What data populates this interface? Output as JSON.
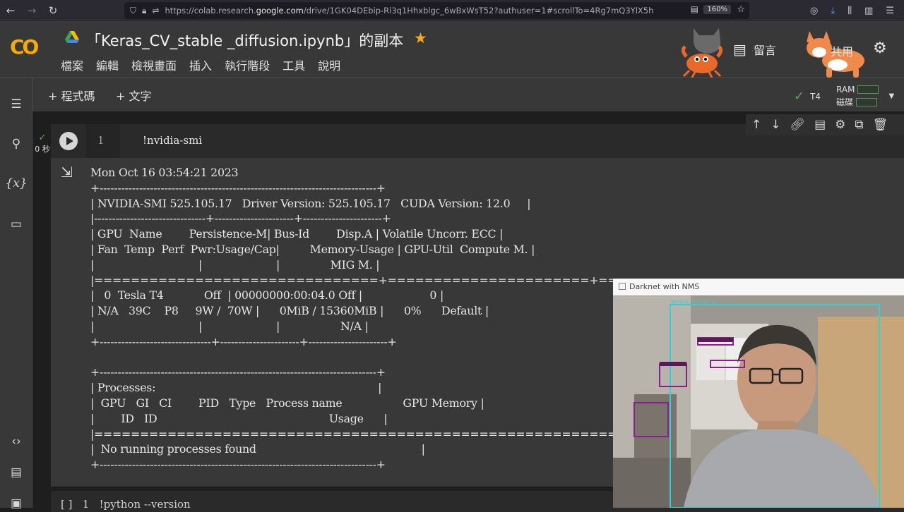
{
  "browser": {
    "url_prefix": "https://colab.research.",
    "url_domain": "google.com",
    "url_path": "/drive/1GK04DEbip-Ri3q1Hhxblgc_6wBxWsT52?authuser=1#scrollTo=4Rg7mQ3YlX5h",
    "zoom": "160%"
  },
  "header": {
    "logo": "CO",
    "title": "「Keras_CV_stable _diffusion.ipynb」的副本",
    "menu": [
      "檔案",
      "編輯",
      "檢視畫面",
      "插入",
      "執行階段",
      "工具",
      "說明"
    ],
    "comment_label": "留言",
    "share_label": "共用"
  },
  "toolbar": {
    "add_code": "+ 程式碼",
    "add_text": "+ 文字",
    "runtime_type": "T4",
    "ram_label": "RAM",
    "disk_label": "磁碟"
  },
  "cell": {
    "exec_time": "0 秒",
    "line_number": "1",
    "code": "!nvidia-smi"
  },
  "output": {
    "lines": [
      "Mon Oct 16 03:54:21 2023",
      "+-----------------------------------------------------------------------------+",
      "| NVIDIA-SMI 525.105.17   Driver Version: 525.105.17   CUDA Version: 12.0     |",
      "|-------------------------------+----------------------+----------------------+",
      "| GPU  Name        Persistence-M| Bus-Id        Disp.A | Volatile Uncorr. ECC |",
      "| Fan  Temp  Perf  Pwr:Usage/Cap|         Memory-Usage | GPU-Util  Compute M. |",
      "|                               |                      |               MIG M. |",
      "|===============================+======================+======================|",
      "|   0  Tesla T4            Off  | 00000000:00:04.0 Off |                    0 |",
      "| N/A   39C    P8     9W /  70W |      0MiB / 15360MiB |      0%      Default |",
      "|                               |                      |                  N/A |",
      "+-------------------------------+----------------------+----------------------+",
      "",
      "+-----------------------------------------------------------------------------+",
      "| Processes:                                                                  |",
      "|  GPU   GI   CI        PID   Type   Process name                  GPU Memory |",
      "|        ID   ID                                                   Usage      |",
      "|=============================================================================|",
      "|  No running processes found                                                 |",
      "+-----------------------------------------------------------------------------+"
    ]
  },
  "next_cell": {
    "text": "[ ]   1   !python --version"
  },
  "webcam": {
    "title": "Darknet with NMS",
    "detection_label": "person: 0.9712 %"
  },
  "colors": {
    "accent_orange": "#f9ab00",
    "check_green": "#4caf50",
    "star": "#f9a825",
    "bbox_cyan": "#2fd3d3",
    "bbox_purple": "#8a1f8a"
  }
}
